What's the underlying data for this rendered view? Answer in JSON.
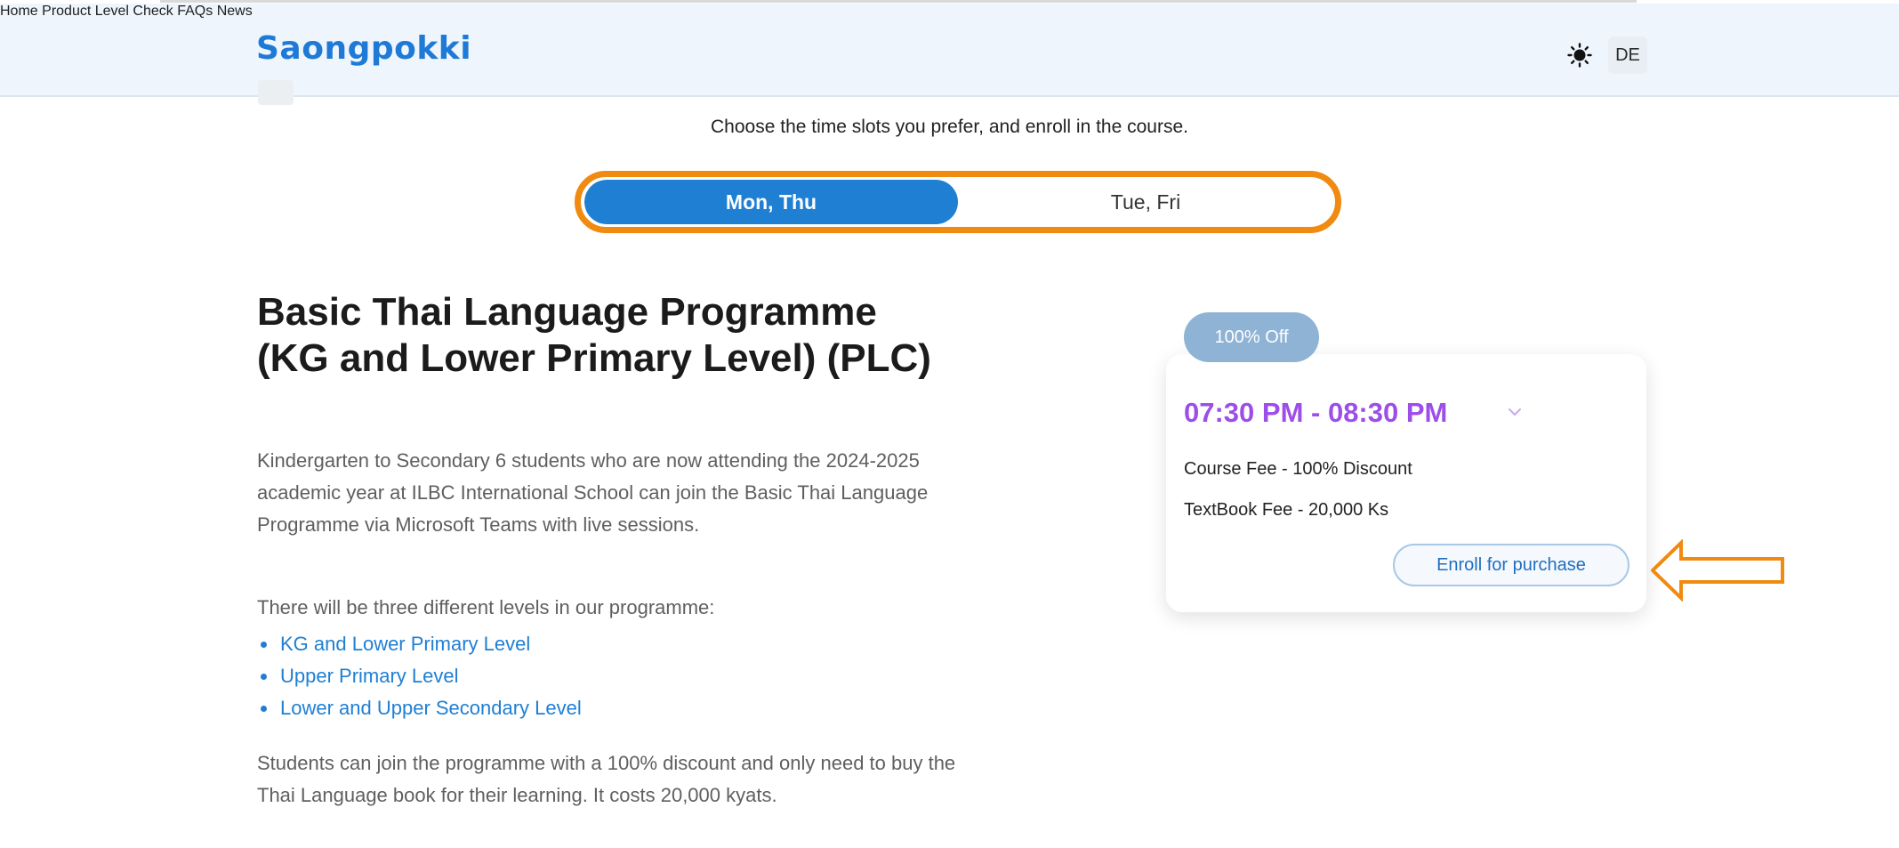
{
  "header": {
    "logo": "Saongpokki",
    "nav": [
      "Home",
      "Product",
      "Level Check",
      "FAQs",
      "News"
    ],
    "language": "DE"
  },
  "schedule": {
    "instructions": "Choose the time slots you prefer, and enroll in the course.",
    "options": [
      "Mon, Thu",
      "Tue, Fri"
    ],
    "selected": "Mon, Thu"
  },
  "course": {
    "title": "Basic Thai Language Programme (KG and Lower Primary Level) (PLC)",
    "description": "Kindergarten to Secondary 6 students who are now attending the 2024-2025 academic year at ILBC International School can join the Basic Thai Language Programme via Microsoft Teams with live sessions.",
    "levels_intro": "There will be three different levels in our programme:",
    "levels": [
      "KG and Lower Primary Level",
      "Upper Primary Level",
      "Lower and Upper Secondary Level"
    ],
    "closing": "Students can join the programme with a 100% discount and only need to buy the Thai Language book for their learning. It costs 20,000 kyats."
  },
  "pricing_card": {
    "badge": "100% Off",
    "time": "07:30 PM - 08:30 PM",
    "course_fee": "Course Fee - 100% Discount",
    "textbook_fee": "TextBook Fee - 20,000 Ks",
    "enroll_label": "Enroll for purchase"
  },
  "colors": {
    "brand": "#1e7ad6",
    "highlight": "#f08a10",
    "time_accent": "#9b4ee8",
    "badge": "#8fb3d4"
  }
}
